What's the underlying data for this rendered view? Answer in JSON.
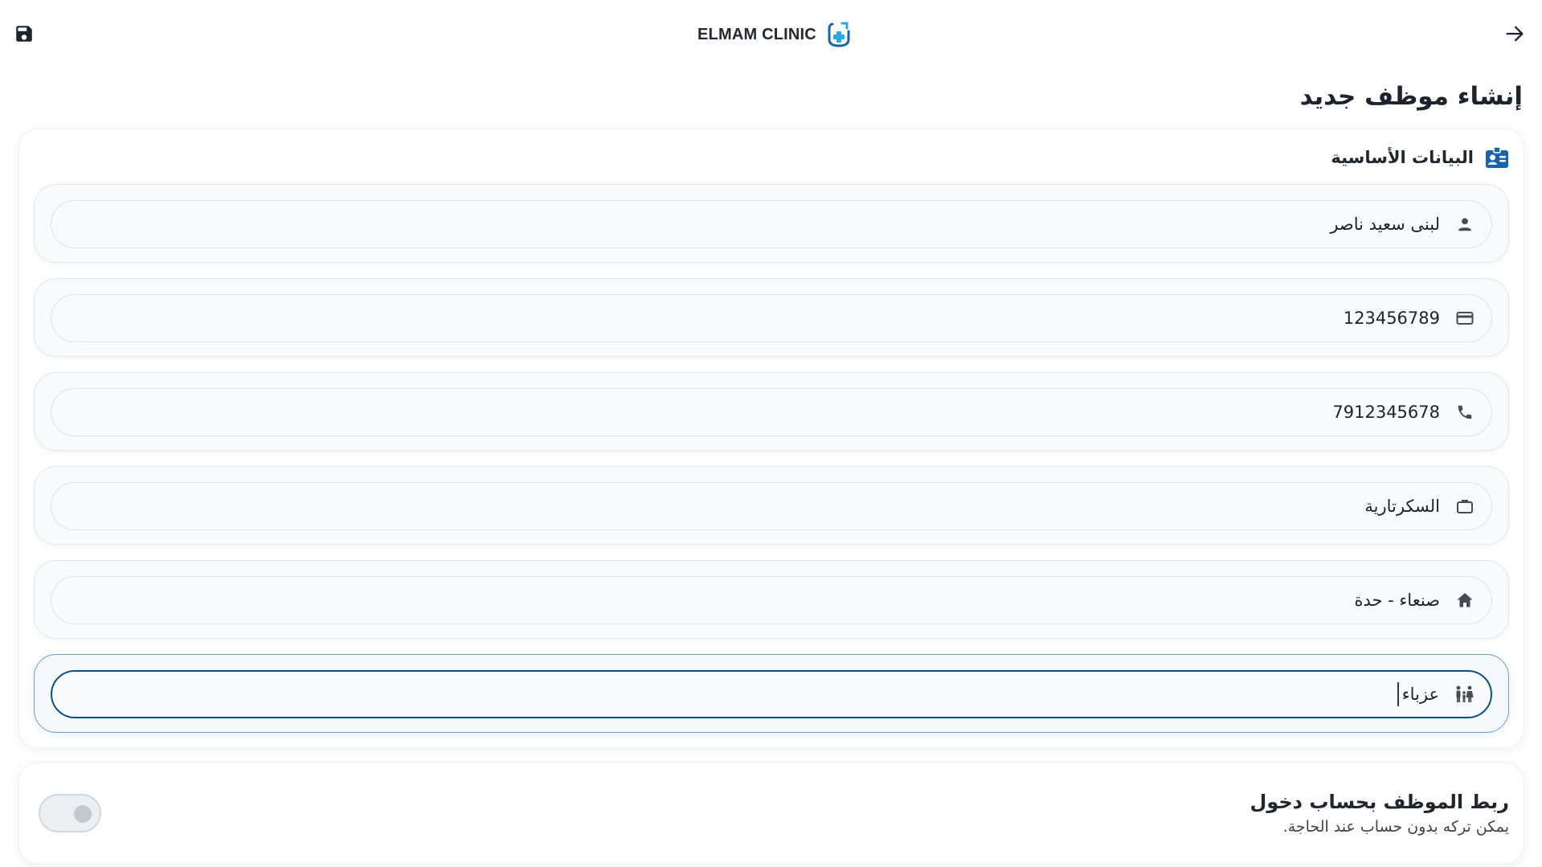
{
  "header": {
    "brand": "ELMAM CLINIC",
    "brand_logo_icon": "clinic-plus-logo-icon",
    "save_icon": "save-icon",
    "back_icon": "arrow-right-icon"
  },
  "page": {
    "title": "إنشاء موظف جديد"
  },
  "basic_info": {
    "title": "البيانات الأساسية",
    "icon": "id-card-icon",
    "fields": [
      {
        "name": "full-name",
        "icon": "person-icon",
        "value": "لبنى سعيد ناصر"
      },
      {
        "name": "national-id",
        "icon": "card-icon",
        "value": "123456789"
      },
      {
        "name": "phone",
        "icon": "phone-icon",
        "value": "7912345678"
      },
      {
        "name": "job",
        "icon": "briefcase-icon",
        "value": "السكرتارية"
      },
      {
        "name": "address",
        "icon": "home-icon",
        "value": "صنعاء - حدة"
      },
      {
        "name": "marital-status",
        "icon": "family-icon",
        "value": "عزباء",
        "focused": true
      }
    ]
  },
  "account_link": {
    "title": "ربط الموظف بحساب دخول",
    "subtitle": "يمكن تركه بدون حساب عند الحاجة.",
    "enabled": false
  },
  "colors": {
    "primary": "#0f4f86",
    "icon_blue": "#1b64a8",
    "logo_light_blue": "#27a9e1"
  }
}
